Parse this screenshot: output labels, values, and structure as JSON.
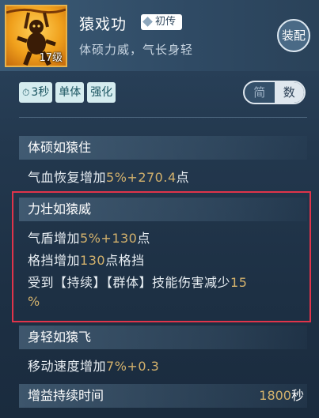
{
  "skill": {
    "name": "猿戏功",
    "tier": "初传",
    "level": "17级",
    "description": "体硕力威，气长身轻",
    "equip_label": "装配"
  },
  "tags": [
    "3秒",
    "单体",
    "强化"
  ],
  "view_toggle": {
    "option_simple": "简",
    "option_numeric": "数",
    "selected": "数"
  },
  "sections": [
    {
      "title": "体硕如猿住",
      "effects": [
        {
          "pre": "气血恢复增加",
          "v1": "5%",
          "mid": "+",
          "v2": "270.4",
          "post": "点"
        }
      ]
    },
    {
      "title": "力壮如猿威",
      "effects": [
        {
          "pre": "气盾增加",
          "v1": "5%",
          "mid": "+",
          "v2": "130",
          "post": "点"
        },
        {
          "pre": "格挡增加",
          "v1": "130",
          "mid": "",
          "v2": "",
          "post": "点格挡"
        },
        {
          "pre": "受到【持续】【群体】技能伤害减少",
          "v1": "15",
          "mid": "",
          "v2": "",
          "post": ""
        },
        {
          "pre": "",
          "v1": "%",
          "mid": "",
          "v2": "",
          "post": ""
        }
      ]
    },
    {
      "title": "身轻如猿飞",
      "effects": [
        {
          "pre": "移动速度增加",
          "v1": "7%",
          "mid": "+",
          "v2": "0.3",
          "post": ""
        }
      ]
    }
  ],
  "duration": {
    "label": "增益持续时间",
    "value": "1800",
    "unit": "秒"
  },
  "colors": {
    "value_gold": "#d3b16c",
    "highlight_red": "#e0344a",
    "tag_bg": "#d5ecef"
  }
}
